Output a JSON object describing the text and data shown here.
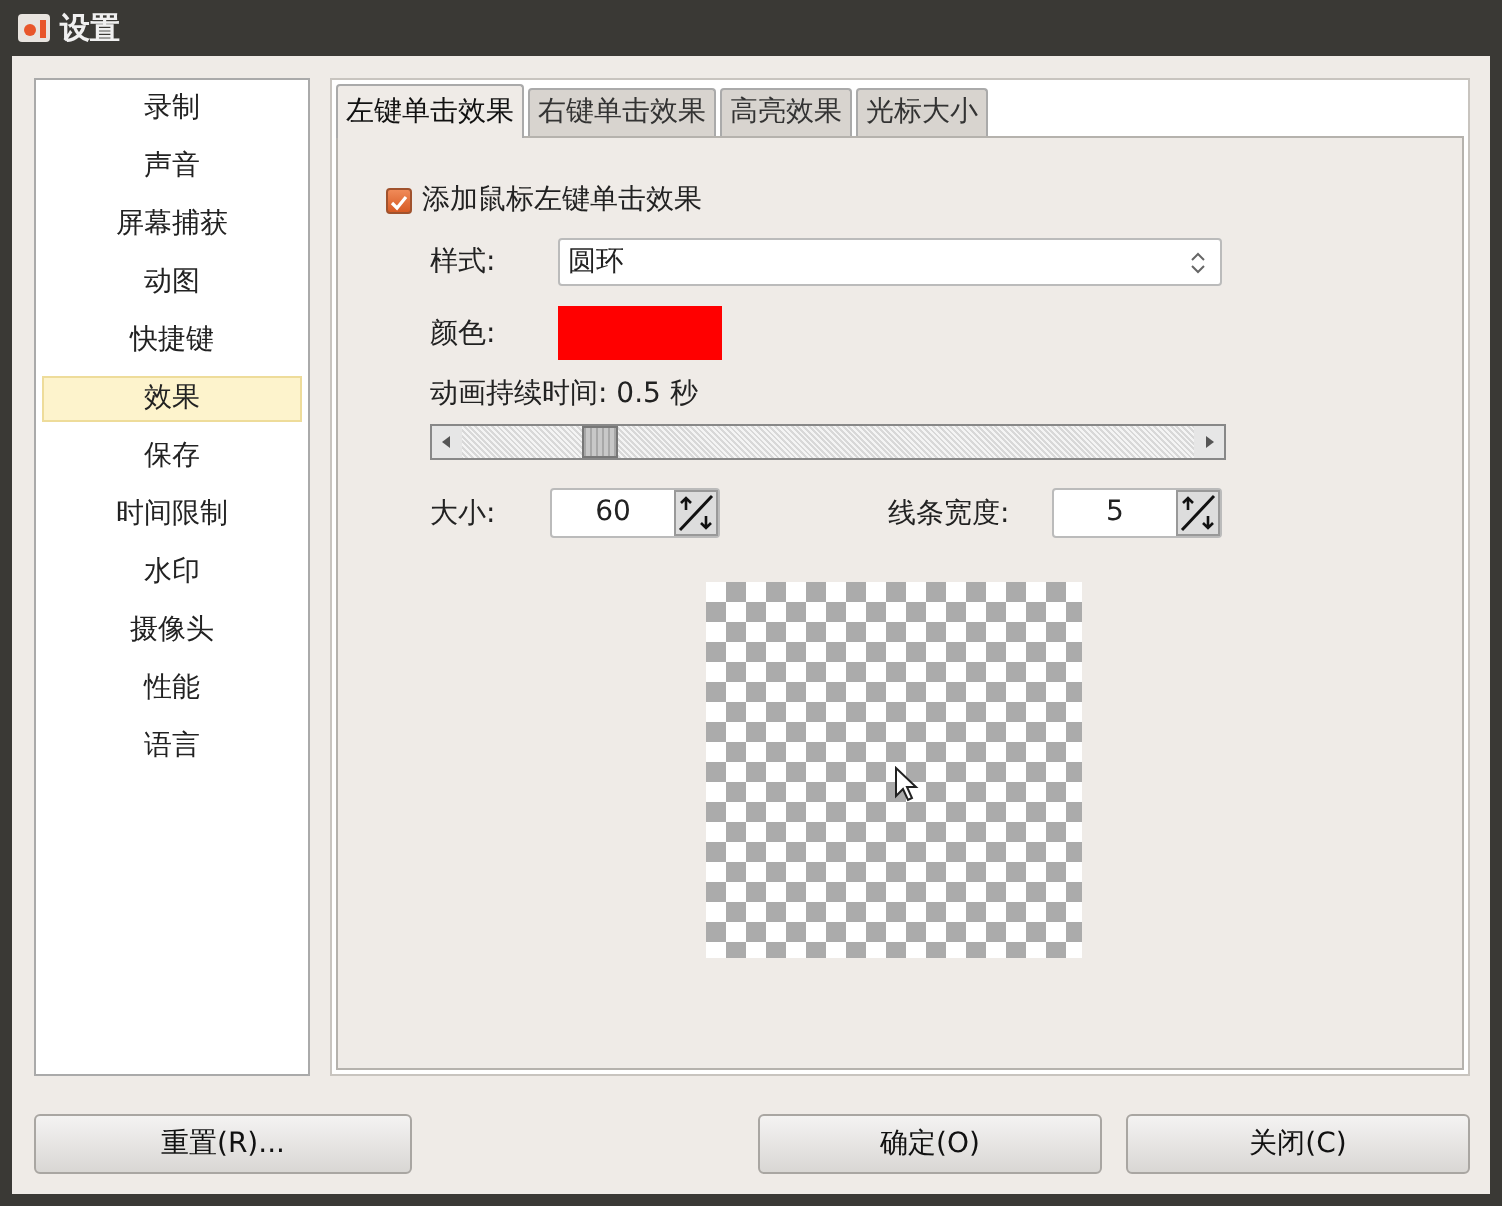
{
  "window": {
    "title": "设置"
  },
  "sidebar": {
    "items": [
      {
        "label": "录制",
        "selected": false
      },
      {
        "label": "声音",
        "selected": false
      },
      {
        "label": "屏幕捕获",
        "selected": false
      },
      {
        "label": "动图",
        "selected": false
      },
      {
        "label": "快捷键",
        "selected": false
      },
      {
        "label": "效果",
        "selected": true
      },
      {
        "label": "保存",
        "selected": false
      },
      {
        "label": "时间限制",
        "selected": false
      },
      {
        "label": "水印",
        "selected": false
      },
      {
        "label": "摄像头",
        "selected": false
      },
      {
        "label": "性能",
        "selected": false
      },
      {
        "label": "语言",
        "selected": false
      }
    ]
  },
  "tabs": [
    {
      "label": "左键单击效果",
      "selected": true
    },
    {
      "label": "右键单击效果",
      "selected": false
    },
    {
      "label": "高亮效果",
      "selected": false
    },
    {
      "label": "光标大小",
      "selected": false
    }
  ],
  "panel": {
    "enable": {
      "label": "添加鼠标左键单击效果",
      "checked": true
    },
    "style": {
      "label": "样式:",
      "value": "圆环"
    },
    "color": {
      "label": "颜色:",
      "color": "#ff0000"
    },
    "duration": {
      "label": "动画持续时间: 0.5 秒",
      "level": 0.17
    },
    "size": {
      "label": "大小:",
      "value": "60"
    },
    "line_width": {
      "label": "线条宽度:",
      "value": "5"
    }
  },
  "buttons": [
    {
      "label": "重置(R)..."
    },
    {
      "label": "确定(O)"
    },
    {
      "label": "关闭(C)"
    }
  ]
}
